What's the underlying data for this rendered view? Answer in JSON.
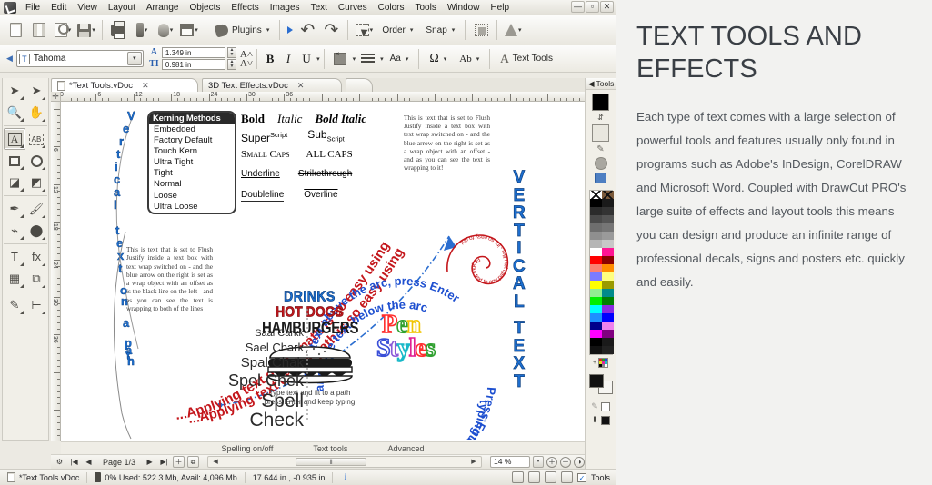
{
  "app": {
    "menu": [
      "File",
      "Edit",
      "View",
      "Layout",
      "Arrange",
      "Objects",
      "Effects",
      "Images",
      "Text",
      "Curves",
      "Colors",
      "Tools",
      "Window",
      "Help"
    ],
    "window_controls": [
      "—",
      "▫",
      "✕"
    ],
    "toolbar1": [
      {
        "name": "new-document",
        "icon": "page-icon",
        "label": ""
      },
      {
        "name": "new-from-template",
        "icon": "pages-icon",
        "label": ""
      },
      {
        "name": "open-document",
        "icon": "open-icon",
        "label": "",
        "caret": "▾"
      },
      {
        "name": "save-document",
        "icon": "save-icon",
        "label": "",
        "caret": "▾"
      },
      {
        "name": "print",
        "icon": "printer-icon",
        "label": ""
      },
      {
        "name": "cut-contour",
        "icon": "cutter-icon",
        "label": "",
        "caret": "▾"
      },
      {
        "name": "print-and-cut",
        "icon": "mouse-icon",
        "label": "",
        "caret": "▾"
      },
      {
        "name": "media-setup",
        "icon": "frame-icon",
        "label": "",
        "caret": "▾"
      },
      {
        "name": "plugins",
        "icon": "plug-icon",
        "label": "Plugins",
        "caret": "▾"
      },
      {
        "name": "run",
        "icon": "play-icon",
        "label": ""
      },
      {
        "name": "undo",
        "icon": "undo-icon",
        "label": ""
      },
      {
        "name": "redo",
        "icon": "redo-icon",
        "label": ""
      },
      {
        "name": "select-mode",
        "icon": "select-icon",
        "label": "",
        "caret": "▾"
      },
      {
        "name": "order",
        "icon": "",
        "label": "Order",
        "caret": "▾"
      },
      {
        "name": "snap",
        "icon": "",
        "label": "Snap",
        "caret": "▾"
      },
      {
        "name": "align",
        "icon": "align-icon",
        "label": ""
      },
      {
        "name": "weed",
        "icon": "cone-icon",
        "label": "",
        "caret": "▾"
      }
    ],
    "toolbar2": {
      "prev_arrow": "◀",
      "font_name": "Tahoma",
      "font_icon_glyph": "T",
      "dropdown_glyph": "▾",
      "width_value": "1.349 in",
      "height_value": "0.981 in",
      "width_icon": "A",
      "height_icon": "TI",
      "size_up": "A˄",
      "size_down": "A˅",
      "bold": "B",
      "italic": "I",
      "underline": "U",
      "underline_caret": "▾",
      "paragraph_caret": "▾",
      "list_caret": "▾",
      "case_label": "Aa",
      "case_caret": "▾",
      "symbol_label": "Ω",
      "symbol_caret": "▾",
      "spell_label": "Ab",
      "spell_caret": "▾",
      "text_tools_label": "Text Tools"
    },
    "tabs": [
      {
        "label": "*Text Tools.vDoc",
        "close": "✕",
        "active": true
      },
      {
        "label": "3D Text Effects.vDoc",
        "close": "✕",
        "active": false
      }
    ],
    "tool_palette": [
      [
        {
          "name": "select-tool",
          "glyph": "➤",
          "selected": false
        },
        {
          "name": "node-edit-tool",
          "glyph": "➤",
          "selected": false
        }
      ],
      [
        {
          "name": "zoom-tool",
          "glyph": "🔍",
          "selected": false
        },
        {
          "name": "pan-tool",
          "glyph": "✋",
          "selected": false
        }
      ],
      [
        {
          "name": "text-tool",
          "glyph": "A",
          "selected": true
        },
        {
          "name": "text-frame-tool",
          "glyph": "AB",
          "selected": false
        }
      ],
      [
        {
          "name": "rectangle-tool",
          "glyph": "▭",
          "selected": false
        },
        {
          "name": "ellipse-tool",
          "glyph": "◯",
          "selected": false
        }
      ],
      [
        {
          "name": "shapes-tool",
          "glyph": "◪",
          "selected": false
        },
        {
          "name": "symbols-tool",
          "glyph": "◩",
          "selected": false
        }
      ],
      [
        {
          "name": "pen-tool",
          "glyph": "✒",
          "selected": false
        },
        {
          "name": "brush-tool",
          "glyph": "🖌",
          "selected": false
        }
      ],
      [
        {
          "name": "eyedropper-tool",
          "glyph": "⌁",
          "selected": false
        },
        {
          "name": "fill-tool",
          "glyph": "⬤",
          "selected": false
        }
      ],
      [
        {
          "name": "text-effects-tool",
          "glyph": "T",
          "selected": false
        },
        {
          "name": "effects-tool",
          "glyph": "fx",
          "selected": false
        }
      ],
      [
        {
          "name": "image-tool",
          "glyph": "▦",
          "selected": false
        },
        {
          "name": "weld-tool",
          "glyph": "⧉",
          "selected": false
        }
      ],
      [
        {
          "name": "contour-tool",
          "glyph": "✎",
          "selected": false
        },
        {
          "name": "measure-tool",
          "glyph": "⊢",
          "selected": false
        }
      ]
    ],
    "ruler": {
      "corner_glyph": "✛",
      "h_labels": [
        "0",
        "6",
        "12",
        "18",
        "24",
        "30",
        "36"
      ],
      "v_labels": [
        "6",
        "12",
        "18",
        "24",
        "30",
        "36"
      ],
      "unit": "in"
    },
    "canvas": {
      "kerning_panel": {
        "title": "Kerning Methods",
        "items": [
          "Embedded",
          "Factory Default",
          "Touch Kern",
          "Ultra Tight",
          "Tight",
          "Normal",
          "Loose",
          "Ultra Loose"
        ]
      },
      "specimens": {
        "row1": [
          "Bold",
          "Italic",
          "Bold Italic"
        ],
        "row2_a": "Super",
        "row2_a_sup": "Script",
        "row2_b": "Sub",
        "row2_b_sub": "Script",
        "row3": [
          "Small Caps",
          "ALL CAPS"
        ],
        "row4": [
          "Underline",
          "Strikethrough"
        ],
        "row5": [
          "Doubleline",
          "Overline"
        ]
      },
      "justify_block_right": "This is text that is set to Flush Justify inside a text box with text wrap switched on - and the blue arrow on the right is set as a wrap object with an offset - and as you can see the text is wrapping to it!",
      "justify_block_left": "This is text that is set to Flush Justify inside a text box with text wrap switched on - and the blue arrow on the right is set as a wrap object with an offset as is the black line on the left - and as you can see the text is wrapping to both of the lines",
      "vertical_path_text": "Vertical text on a path",
      "vertical_text": [
        "VERTICAL",
        "TEXT"
      ],
      "path_text_outer": "Applying text onto a path is so easy using VinylMaster...",
      "path_text_inner": "...Applying text onto a path is so easy using VinylMaster...",
      "arc_text_top": "Type text above the arc, press Enter and type text below the arc",
      "arc_text_bottom": "Press Enter again and keep typing For text Above & Below...",
      "spiral_text": "Fit your text to any path you like - it's so easy to do!",
      "menu_board": {
        "drinks": "DRINKS",
        "hot_dogs": "HOT DOGS",
        "hamburgers": "HAMBURGERS",
        "caption": "Type text and fit to a path press Enter and keep typing"
      },
      "spell_check_list": [
        "Saal Carkk",
        "Sael Chark",
        "Spal Chak",
        "Spel Chek",
        "Spell Check"
      ],
      "pen_styles": [
        "Pen",
        "Styles"
      ],
      "pen_styles_colors": [
        "#ff2d2d",
        "#2fa02f",
        "#f0c400",
        "#3a4fd8",
        "#8a5ad8",
        "#17b8c8",
        "#e02090"
      ]
    },
    "bottom_tabs": [
      "Spelling on/off",
      "Text tools",
      "Advanced"
    ],
    "page_nav": {
      "first": "|◀",
      "prev": "◀",
      "label": "Page 1/3",
      "next": "▶",
      "last": "▶|",
      "add_page_icon": "add-page-icon",
      "duplicate_page_icon": "duplicate-page-icon",
      "scroll_left": "◀",
      "scroll_right": "▶",
      "thumb_grip": "⦀"
    },
    "zoom": {
      "value": "14 %",
      "dropdown": "▾",
      "buttons": [
        "＋",
        "－",
        "◑",
        "⊗"
      ]
    },
    "statusbar": {
      "document": "*Text Tools.vDoc",
      "memory": "0%  Used: 522.3 Mb, Avail: 4,096 Mb",
      "coordinates": "17.644 in , -0.935 in",
      "info_glyph": "i",
      "tools_label": "Tools",
      "checkbox": "✓"
    },
    "color_dock": {
      "header_arrow": "◀",
      "header_label": "Tools",
      "fill_color": "#000000",
      "stroke_color": "#e9e7df",
      "swatches": [
        "#ffffff-none",
        "#7b5a3a-none",
        "#000000",
        "#1a1a1a",
        "#2b2b2b",
        "#333333",
        "#4a4a4a",
        "#555555",
        "#6e6e6e",
        "#767676",
        "#8f8f8f",
        "#9a9a9a",
        "#b5b5b5",
        "#c7c7c7",
        "#ffffff",
        "#ff1493",
        "#ff0000",
        "#8b0000",
        "#fa8072",
        "#ff8c00",
        "#7b7bff",
        "#ffff80",
        "#ffff00",
        "#9a9a00",
        "#90ee90",
        "#008b8b",
        "#00ee00",
        "#008000",
        "#00ffff",
        "#8a2be2",
        "#1e90ff",
        "#0000ff",
        "#00008b",
        "#ee82ee",
        "#ff00ff",
        "#800080",
        "#000000",
        "#1a1a1a",
        "#111111",
        "#222222"
      ]
    }
  },
  "article": {
    "title": "TEXT TOOLS AND EFFECTS",
    "body": "Each type of text comes with a large selection of powerful tools and features usually only found in programs such as Adobe's InDesign, CorelDRAW and Microsoft Word. Coupled with DrawCut PRO's large suite of effects and layout tools this means you can design and produce an infinite range of professional decals, signs and posters etc. quickly and easily."
  }
}
